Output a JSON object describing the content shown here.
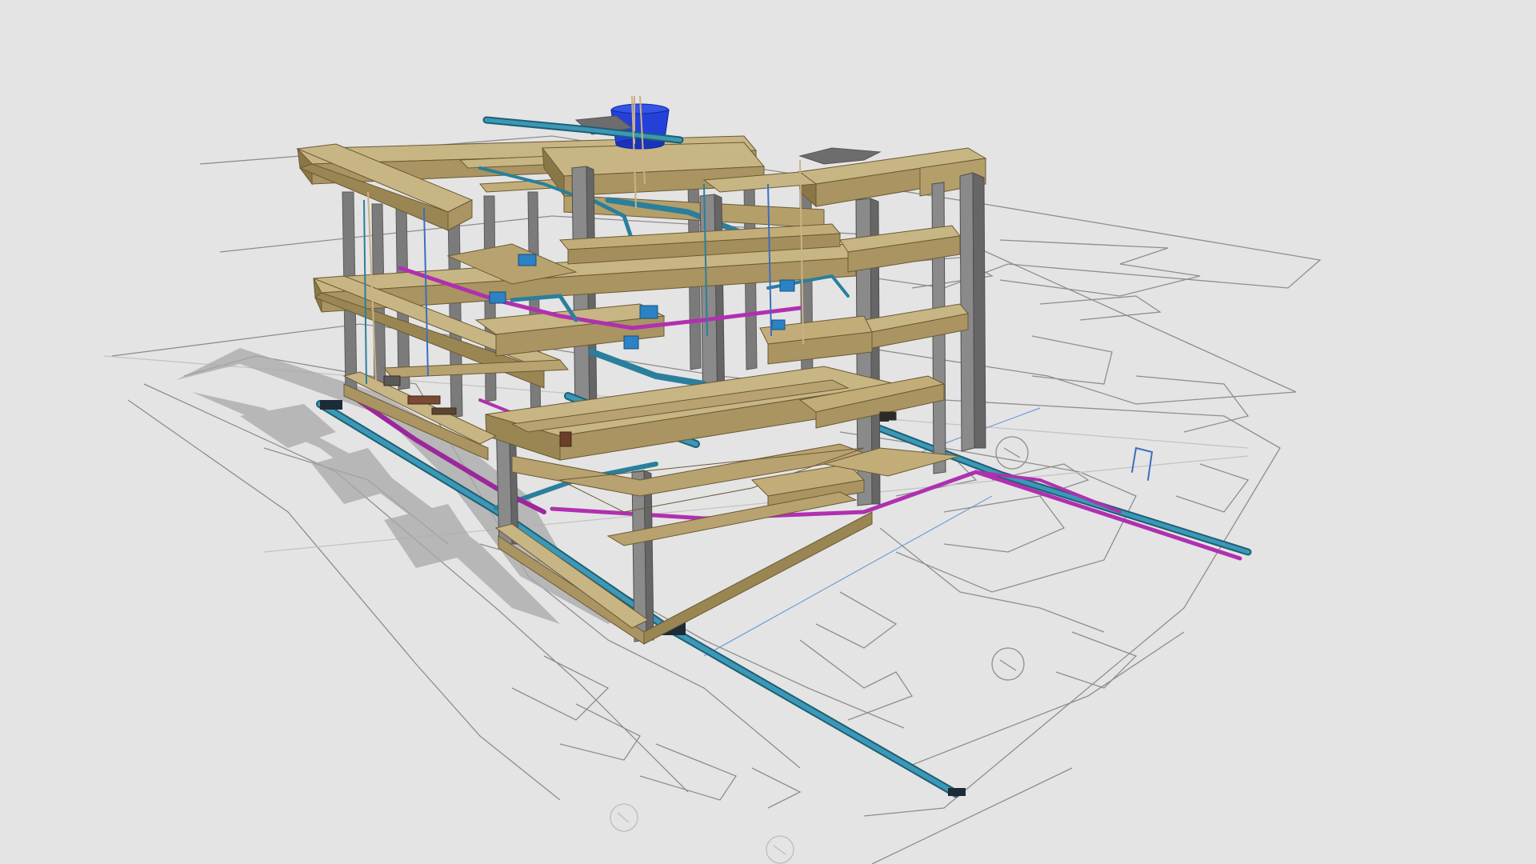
{
  "viewer": {
    "background": "#e4e4e4",
    "content": "3d-bim-model",
    "visible_text": []
  },
  "model": {
    "icon": "building-structure",
    "layers": [
      {
        "name": "beams",
        "color": "#b39d6a"
      },
      {
        "name": "columns",
        "color": "#7d7d7d"
      },
      {
        "name": "water-pipes",
        "color": "#2f8aa6"
      },
      {
        "name": "drain-pipes",
        "color": "#b030b0"
      },
      {
        "name": "water-tank",
        "color": "#1f3fd6"
      },
      {
        "name": "floor-plan-lines",
        "color": "#8a8a8a"
      }
    ]
  }
}
